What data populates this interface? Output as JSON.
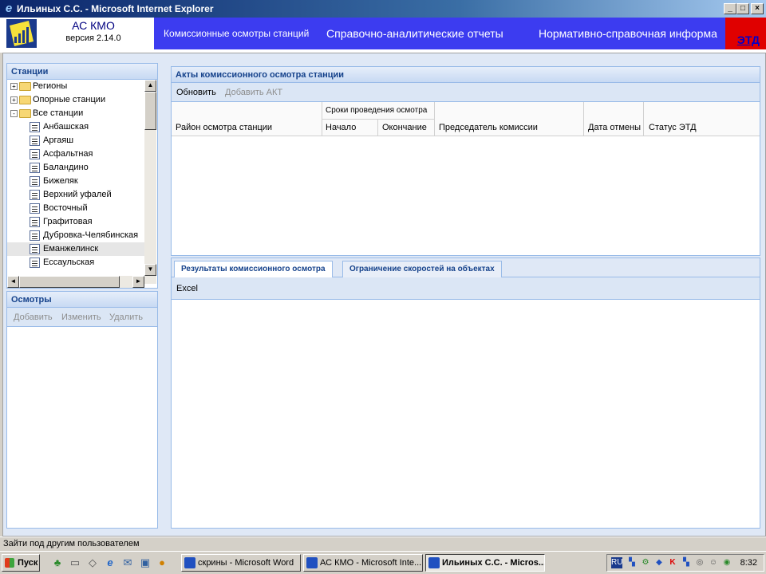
{
  "window": {
    "title": "Ильиных С.С. - Microsoft Internet Explorer",
    "minimize": "_",
    "maximize": "□",
    "close": "×"
  },
  "app": {
    "name": "АС КМО",
    "version": "версия 2.14.0"
  },
  "nav": {
    "items": [
      "Комиссионные осмотры станций",
      "Справочно-аналитические отчеты",
      "Нормативно-справочная информа"
    ],
    "etd": "ЭТД"
  },
  "stations": {
    "title": "Станции",
    "nodes": [
      {
        "label": "Регионы",
        "type": "folder",
        "level": 0,
        "expander": "+"
      },
      {
        "label": "Опорные станции",
        "type": "folder",
        "level": 0,
        "expander": "+"
      },
      {
        "label": "Все станции",
        "type": "folder",
        "level": 0,
        "expander": "−"
      },
      {
        "label": "Анбашская",
        "type": "leaf",
        "level": 1
      },
      {
        "label": "Аргаяш",
        "type": "leaf",
        "level": 1
      },
      {
        "label": "Асфальтная",
        "type": "leaf",
        "level": 1
      },
      {
        "label": "Баландино",
        "type": "leaf",
        "level": 1
      },
      {
        "label": "Бижеляк",
        "type": "leaf",
        "level": 1
      },
      {
        "label": "Верхний уфалей",
        "type": "leaf",
        "level": 1
      },
      {
        "label": "Восточный",
        "type": "leaf",
        "level": 1
      },
      {
        "label": "Графитовая",
        "type": "leaf",
        "level": 1
      },
      {
        "label": "Дубровка-Челябинская",
        "type": "leaf",
        "level": 1
      },
      {
        "label": "Еманжелинск",
        "type": "leaf",
        "level": 1,
        "selected": true
      },
      {
        "label": "Ессаульская",
        "type": "leaf",
        "level": 1
      }
    ]
  },
  "inspections": {
    "title": "Осмотры",
    "add": "Добавить",
    "edit": "Изменить",
    "delete": "Удалить"
  },
  "acts": {
    "title": "Акты комиссионного осмотра станции",
    "refresh": "Обновить",
    "add": "Добавить АКТ",
    "group_header": "Сроки проведения осмотра",
    "columns": [
      "Район осмотра станции",
      "Начало",
      "Окончание",
      "Председатель комиссии",
      "Дата отмены",
      "Статус ЭТД"
    ]
  },
  "tabs": {
    "items": [
      "Результаты комиссионного осмотра",
      "Ограничение скоростей на объектах"
    ],
    "active": 0
  },
  "results": {
    "excel": "Excel"
  },
  "status": {
    "text": "Зайти под другим пользователем"
  },
  "taskbar": {
    "start": "Пуск",
    "tasks": [
      "скрины - Microsoft Word",
      "АС КМО - Microsoft Inte...",
      "Ильиных С.С. - Micros..."
    ],
    "active_task": 2,
    "lang": "RU",
    "time": "8:32"
  },
  "colors": {
    "nav_bg": "#3c3cf0",
    "etd_bg": "#e00000",
    "panel_header": "#15428b"
  }
}
